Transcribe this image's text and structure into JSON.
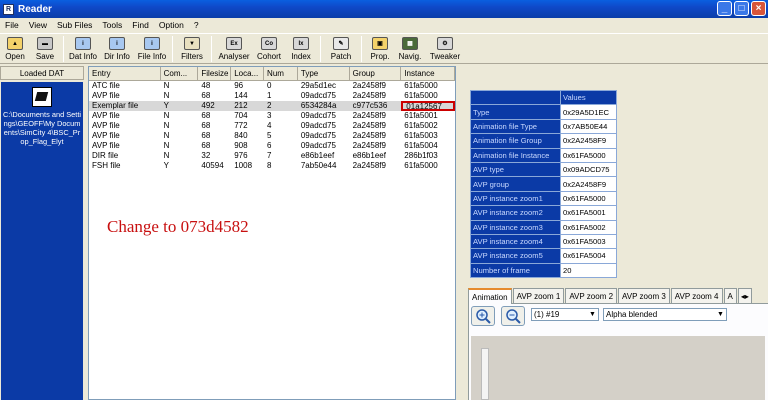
{
  "window": {
    "title": "Reader",
    "app_icon": "R"
  },
  "menu": [
    "File",
    "View",
    "Sub Files",
    "Tools",
    "Find",
    "Option",
    "?"
  ],
  "toolbar": [
    {
      "label": "Open",
      "icon": "open-icon"
    },
    {
      "label": "Save",
      "icon": "save-icon"
    },
    {
      "label": "Dat Info",
      "icon": "dat-info-icon"
    },
    {
      "label": "Dir Info",
      "icon": "dir-info-icon"
    },
    {
      "label": "File Info",
      "icon": "file-info-icon"
    },
    {
      "label": "Filters",
      "icon": "filters-icon"
    },
    {
      "label": "Analyser",
      "icon": "analyser-icon"
    },
    {
      "label": "Cohort",
      "icon": "cohort-icon"
    },
    {
      "label": "Index",
      "icon": "index-icon"
    },
    {
      "label": "Patch",
      "icon": "patch-icon"
    },
    {
      "label": "Prop.",
      "icon": "prop-icon"
    },
    {
      "label": "Navig.",
      "icon": "navig-icon"
    },
    {
      "label": "Tweaker",
      "icon": "tweaker-icon"
    }
  ],
  "left_panel": {
    "header": "Loaded DAT",
    "path": "C:\\Documents and Settings\\GEOFF\\My Documents\\SimCity 4\\BSC_Prop_Flag_Elyt"
  },
  "list": {
    "columns": [
      "Entry",
      "Com...",
      "Filesize",
      "Loca...",
      "Num",
      "Type",
      "Group",
      "Instance"
    ],
    "rows": [
      [
        "ATC file",
        "N",
        "48",
        "96",
        "0",
        "29a5d1ec",
        "2a2458f9",
        "61fa5000"
      ],
      [
        "AVP file",
        "N",
        "68",
        "144",
        "1",
        "09adcd75",
        "2a2458f9",
        "61fa5000"
      ],
      [
        "Exemplar file",
        "Y",
        "492",
        "212",
        "2",
        "6534284a",
        "c977c536",
        "01a12567"
      ],
      [
        "AVP file",
        "N",
        "68",
        "704",
        "3",
        "09adcd75",
        "2a2458f9",
        "61fa5001"
      ],
      [
        "AVP file",
        "N",
        "68",
        "772",
        "4",
        "09adcd75",
        "2a2458f9",
        "61fa5002"
      ],
      [
        "AVP file",
        "N",
        "68",
        "840",
        "5",
        "09adcd75",
        "2a2458f9",
        "61fa5003"
      ],
      [
        "AVP file",
        "N",
        "68",
        "908",
        "6",
        "09adcd75",
        "2a2458f9",
        "61fa5004"
      ],
      [
        "DIR file",
        "N",
        "32",
        "976",
        "7",
        "e86b1eef",
        "e86b1eef",
        "286b1f03"
      ],
      [
        "FSH file",
        "Y",
        "40594",
        "1008",
        "8",
        "7ab50e44",
        "2a2458f9",
        "61fa5000"
      ]
    ],
    "selected_row": 2,
    "highlighted_cell": "01a12567",
    "annotation": "Change to 073d4582"
  },
  "properties": {
    "header": "Values",
    "rows": [
      {
        "key": "Type",
        "value": "0x29A5D1EC"
      },
      {
        "key": "Animation file Type",
        "value": "0x7AB50E44"
      },
      {
        "key": "Animation file Group",
        "value": "0x2A2458F9"
      },
      {
        "key": "Animation file Instance",
        "value": "0x61FA5000"
      },
      {
        "key": "AVP type",
        "value": "0x09ADCD75"
      },
      {
        "key": "AVP group",
        "value": "0x2A2458F9"
      },
      {
        "key": "AVP instance zoom1",
        "value": "0x61FA5000"
      },
      {
        "key": "AVP instance zoom2",
        "value": "0x61FA5001"
      },
      {
        "key": "AVP instance zoom3",
        "value": "0x61FA5002"
      },
      {
        "key": "AVP instance zoom4",
        "value": "0x61FA5003"
      },
      {
        "key": "AVP instance zoom5",
        "value": "0x61FA5004"
      },
      {
        "key": "Number of frame",
        "value": "20"
      }
    ]
  },
  "tabs": [
    "Animation",
    "AVP zoom 1",
    "AVP zoom 2",
    "AVP zoom 3",
    "AVP zoom 4",
    "A"
  ],
  "animation_panel": {
    "frame_select": "(1) #19",
    "blend_select": "Alpha blended"
  },
  "colors": {
    "titlebar": "#0a5fe0",
    "panel_blue": "#0b3aa6",
    "annotation": "#c81010"
  }
}
